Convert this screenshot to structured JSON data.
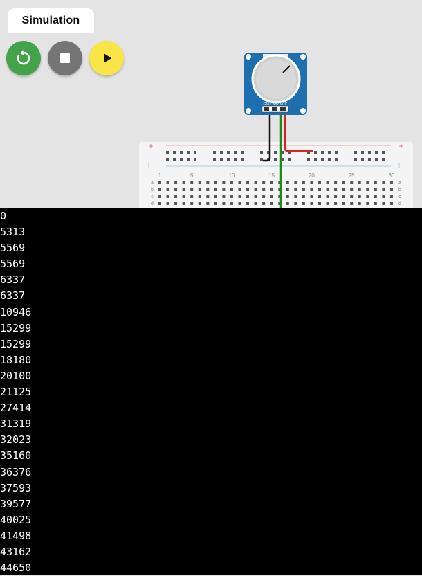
{
  "simulation_tab": {
    "label": "Simulation"
  },
  "toolbar": {
    "restart": {
      "icon": "restart-icon",
      "color": "#44a34a"
    },
    "stop": {
      "icon": "stop-icon",
      "color": "#757575"
    },
    "play": {
      "icon": "play-icon",
      "color": "#f9e547"
    }
  },
  "potentiometer": {
    "pins": [
      "GND",
      "SIG",
      "VCC"
    ],
    "board_color": "#1e6fb0"
  },
  "breadboard": {
    "column_labels": [
      "1",
      "5",
      "10",
      "15",
      "20",
      "25",
      "30"
    ],
    "row_labels": [
      "a",
      "b",
      "c",
      "d"
    ],
    "rail_plus": "+"
  },
  "wires": {
    "gnd_color": "#111111",
    "sig_color": "#1a8c1a",
    "vcc_color": "#e02020"
  },
  "serial_monitor": {
    "lines": [
      "0",
      "5313",
      "5569",
      "5569",
      "6337",
      "6337",
      "10946",
      "15299",
      "15299",
      "18180",
      "20100",
      "21125",
      "27414",
      "31319",
      "32023",
      "35160",
      "36376",
      "37593",
      "39577",
      "40025",
      "41498",
      "43162",
      "44650"
    ]
  }
}
